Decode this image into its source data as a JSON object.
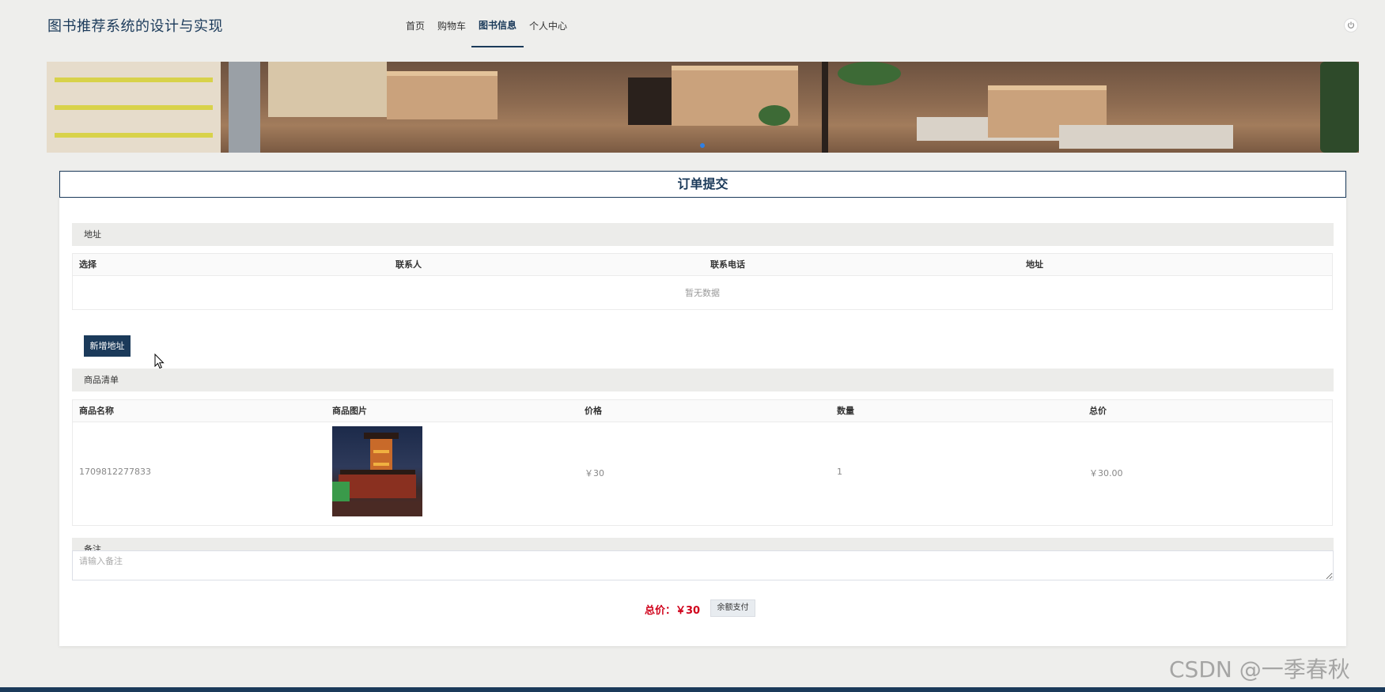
{
  "header": {
    "site_title": "图书推荐系统的设计与实现",
    "nav": [
      {
        "label": "首页",
        "active": false
      },
      {
        "label": "购物车",
        "active": false
      },
      {
        "label": "图书信息",
        "active": true
      },
      {
        "label": "个人中心",
        "active": false
      }
    ],
    "power_icon": "power-icon"
  },
  "banner": {
    "active_slide": 1
  },
  "order": {
    "title": "订单提交",
    "address_section": {
      "heading": "地址",
      "columns": [
        "选择",
        "联系人",
        "联系电话",
        "地址"
      ],
      "empty_text": "暂无数据",
      "add_button": "新增地址"
    },
    "goods_section": {
      "heading": "商品清单",
      "columns": [
        "商品名称",
        "商品图片",
        "价格",
        "数量",
        "总价"
      ],
      "rows": [
        {
          "name": "1709812277833",
          "price": "￥30",
          "quantity": "1",
          "total": "￥30.00"
        }
      ]
    },
    "remark": {
      "heading": "备注",
      "placeholder": "请输入备注"
    },
    "total_label": "总价：￥30",
    "pay_button": "余额支付"
  },
  "watermark": "CSDN @一季春秋",
  "colors": {
    "primary": "#1b3a5a",
    "price_red": "#d0021b",
    "page_bg": "#eeeeec"
  }
}
